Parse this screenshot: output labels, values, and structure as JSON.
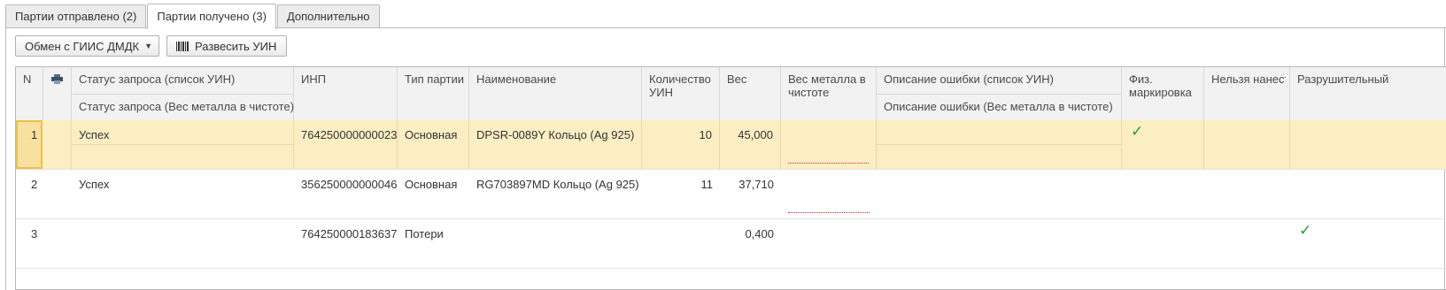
{
  "tabs": [
    {
      "label": "Партии отправлено (2)"
    },
    {
      "label": "Партии получено (3)"
    },
    {
      "label": "Дополнительно"
    }
  ],
  "toolbar": {
    "exchange_label": "Обмен с ГИИС ДМДК",
    "unpack_label": "Развесить УИН"
  },
  "grid": {
    "headers": {
      "n": "N",
      "status": "Статус запроса (список УИН)",
      "status_sub": "Статус запроса (Вес металла в чистоте)",
      "inp": "ИНП",
      "type": "Тип партии",
      "name": "Наименование",
      "qty": "Количество УИН",
      "weight": "Вес",
      "metal": "Вес металла в чистоте",
      "error": "Описание ошибки (список УИН)",
      "error_sub": "Описание ошибки (Вес металла в чистоте)",
      "phys": "Физ. маркировка",
      "cannot": "Нельзя нанести физ…",
      "destructive": "Разрушительный"
    },
    "rows": [
      {
        "n": "1",
        "status": "Успех",
        "inp": "764250000000023",
        "type": "Основная",
        "name": "DPSR-0089Y Кольцо (Ag 925)",
        "qty": "10",
        "weight": "45,000",
        "phys": true,
        "destructive": false
      },
      {
        "n": "2",
        "status": "Успех",
        "inp": "356250000000046",
        "type": "Основная",
        "name": "RG703897MD Кольцо (Ag 925)",
        "qty": "11",
        "weight": "37,710",
        "phys": false,
        "destructive": false
      },
      {
        "n": "3",
        "status": "",
        "inp": "764250000183637",
        "type": "Потери",
        "name": "",
        "qty": "",
        "weight": "0,400",
        "phys": false,
        "destructive": true
      }
    ]
  },
  "colors": {
    "selected_row": "#fbeec3",
    "check": "#20a030",
    "error_underline": "#dd2222"
  },
  "icons": {
    "print": "printer-icon",
    "check": "checkmark-icon",
    "barcode": "barcode-icon"
  }
}
